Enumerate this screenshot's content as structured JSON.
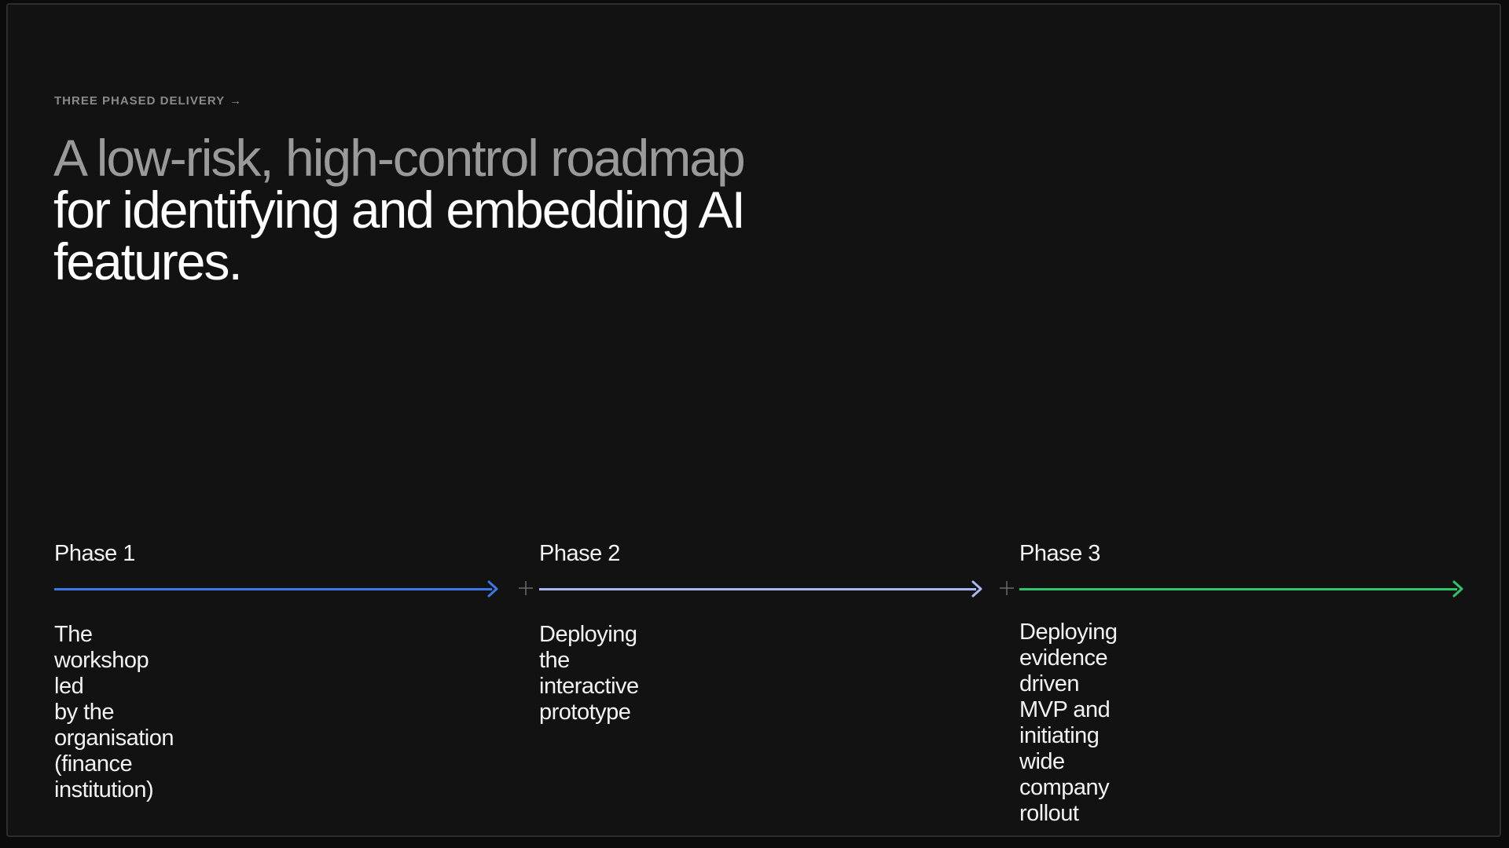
{
  "eyebrow": {
    "label": "THREE PHASED DELIVERY",
    "arrow": "→"
  },
  "headline": {
    "muted": "A low-risk, high-control roadmap",
    "bright": " for identifying and embedding AI features."
  },
  "phases": [
    {
      "title": "Phase 1",
      "description": "The workshop led\nby the organisation\n(finance institution)",
      "color": "#3b78e7"
    },
    {
      "title": "Phase 2",
      "description": "Deploying the\ninteractive  prototype",
      "color": "#a7b8f2"
    },
    {
      "title": "Phase 3",
      "description": "Deploying evidence\ndriven MVP and initiating\nwide company rollout",
      "color": "#2ec46b"
    }
  ],
  "separator_icon": "plus-icon",
  "colors": {
    "background": "#121212",
    "text": "#f2f2f2",
    "muted_text": "#9a9a9a"
  }
}
